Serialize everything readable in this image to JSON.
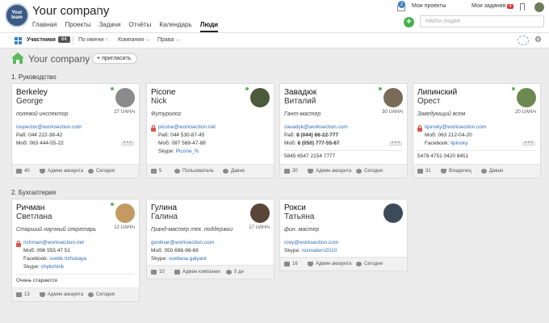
{
  "header": {
    "logo_text": "Your",
    "logo_text2": "team",
    "title": "Your company",
    "nav": [
      "Главная",
      "Проекты",
      "Задачи",
      "Отчёты",
      "Календарь",
      "Люди"
    ],
    "projects_badge": "2",
    "my_projects": "Мои проекты",
    "my_tasks": "Мои задания",
    "tasks_badge": "4",
    "search_placeholder": "Найти людей",
    "add_symbol": "+"
  },
  "toolbar": {
    "members_label": "Участники",
    "members_count": "64",
    "sort_label": "По имени",
    "sort_arrow": "↑",
    "companies_label": "Компания",
    "rights_label": "Права",
    "chevron": "⌵",
    "gear": "⚙"
  },
  "page": {
    "company": "Your company",
    "invite_plus": "+",
    "invite_label": "пригласить"
  },
  "sections": [
    {
      "title": "1. Руководство"
    },
    {
      "title": "2. Бухгалтерия"
    }
  ],
  "cards": [
    {
      "first": "Berkeley",
      "last": "George",
      "role": "полевой инспектор",
      "rate": "27 UAH/ч",
      "email": "inspector@worksection.com",
      "work_label": "Раб:",
      "work": "044 222-38-42",
      "mob_label": "Моб:",
      "mob": "063 444-55-22",
      "foot_count": "40",
      "foot_rights": "Админ аккаунта",
      "foot_last": "Сегодня",
      "avatar_color": "#8b8b8b"
    },
    {
      "first": "Picone",
      "last": "Nick",
      "role": "Футуролог",
      "rate": "",
      "email": "picone@worksection.net",
      "work_label": "Раб:",
      "work": "044 530-87-45",
      "mob_label": "Моб:",
      "mob": "087 568-47-88",
      "skype_label": "Skype:",
      "skype": "Picone_N",
      "foot_count": "5",
      "foot_rights": "Пользователь",
      "foot_last": "Давно",
      "avatar_color": "#4a5a3a"
    },
    {
      "first": "Завадюк",
      "last": "Виталий",
      "role": "Гант-мастер",
      "rate": "30 UAH/ч",
      "email": "zavadyk@worksection.com",
      "work_label": "Раб:",
      "work": "8 (044) 66-22-777",
      "mob_label": "Моб:",
      "mob": "8 (050) 777-55-67",
      "note": "5845 6547 2154 7777",
      "foot_count": "30",
      "foot_rights": "Админ аккаунта",
      "foot_last": "Сегодня",
      "avatar_color": "#7a6a58"
    },
    {
      "first": "Липинский",
      "last": "Орест",
      "role": "Заведующий всем",
      "rate": "20 UAH/ч",
      "email": "lipinsky@worksection.com",
      "mob_label": "Моб:",
      "mob": "063 212-04-20",
      "facebook_label": "Facebook:",
      "facebook": "lipinsky",
      "note": "5478 4751 0420 8451",
      "foot_count": "31",
      "foot_rights": "Владелец",
      "foot_last": "Давно",
      "avatar_color": "#6c8a4f"
    },
    {
      "first": "Ричман",
      "last": "Светлана",
      "role": "Старший научный секретарь",
      "rate": "12 UAH/ч",
      "email": "richman@worksection.net",
      "mob_label": "Моб:",
      "mob": "096 555 47 51",
      "facebook_label": "Facebook:",
      "facebook": "svetik.rizhskaya",
      "skype_label": "Skype:",
      "skype": "chykchirik",
      "note": "Очень старается",
      "foot_count": "13",
      "foot_rights": "Админ аккаунта",
      "foot_last": "Сегодня",
      "avatar_color": "#c49a62"
    },
    {
      "first": "Гулина",
      "last": "Галина",
      "role": "Гранд-мастер тех. поддержки",
      "rate": "17 UAH/ч",
      "email": "goolinar@worksection.com",
      "mob_label": "Моб:",
      "mob": "050 696-96-69",
      "skype_label": "Skype:",
      "skype": "svetlana.galyant",
      "foot_count": "10",
      "foot_rights": "Админ компании",
      "foot_last": "5 дн",
      "avatar_color": "#5a4638"
    },
    {
      "first": "Рокси",
      "last": "Татьяна",
      "role": "фин. мастер",
      "rate": "",
      "email": "roxy@worksection.com",
      "skype_label": "Skype:",
      "skype": "roxmatern2010",
      "foot_count": "16",
      "foot_rights": "Админ аккаунта",
      "foot_last": "Сегодня",
      "avatar_color": "#3c4a5a"
    }
  ],
  "more_label": "• • •"
}
